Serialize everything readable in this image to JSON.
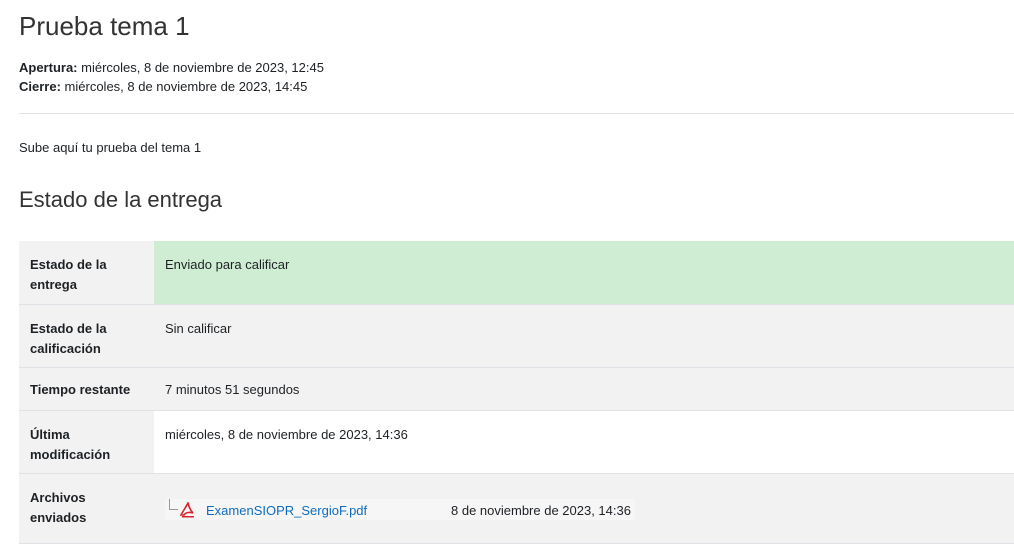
{
  "page": {
    "title": "Prueba tema 1"
  },
  "dates": {
    "open_label": "Apertura:",
    "open_value": "miércoles, 8 de noviembre de 2023, 12:45",
    "close_label": "Cierre:",
    "close_value": "miércoles, 8 de noviembre de 2023, 14:45"
  },
  "intro": "Sube aquí tu prueba del tema 1",
  "submission": {
    "heading": "Estado de la entrega",
    "rows": [
      {
        "label": "Estado de la entrega",
        "value": "Enviado para calificar"
      },
      {
        "label": "Estado de la calificación",
        "value": "Sin calificar"
      },
      {
        "label": "Tiempo restante",
        "value": "7 minutos 51 segundos"
      },
      {
        "label": "Última modificación",
        "value": "miércoles, 8 de noviembre de 2023, 14:36"
      },
      {
        "label": "Archivos enviados",
        "value": ""
      }
    ],
    "file": {
      "name": "ExamenSIOPR_SergioF.pdf",
      "date": "8 de noviembre de 2023, 14:36",
      "icon": "pdf-file-icon"
    }
  },
  "colors": {
    "submitted_bg": "#cfedd3",
    "label_bg": "#f2f2f2",
    "link": "#0f6cbf"
  }
}
